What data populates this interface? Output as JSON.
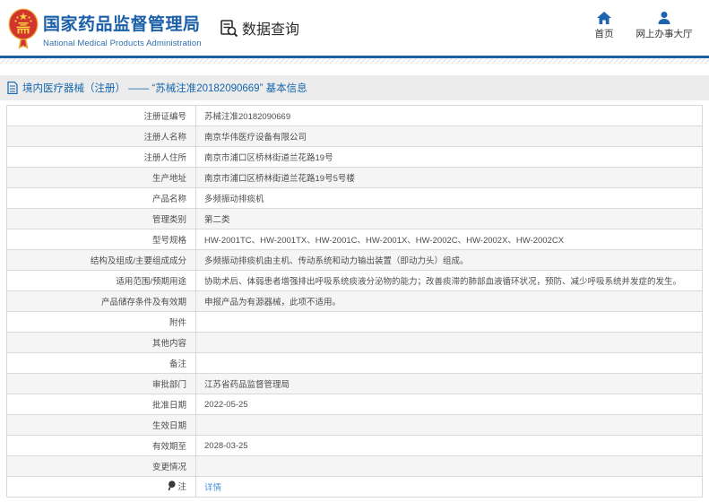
{
  "header": {
    "title": "国家药品监督管理局",
    "subtitle": "National Medical Products Administration",
    "nav": {
      "data_query": "数据查询"
    },
    "quick_links": {
      "home": "首页",
      "service_hall": "网上办事大厅"
    }
  },
  "icons": {
    "emblem": "china-national-emblem",
    "data_query": "document-magnifier",
    "home": "home",
    "service_hall": "person",
    "breadcrumb": "document",
    "note": "pin"
  },
  "colors": {
    "brand_blue": "#1b5fa8",
    "line_blue": "#1c5fa5",
    "link_blue": "#4a90d9",
    "breadcrumb_bg": "#ececec",
    "stripe": "#f5f5f5"
  },
  "breadcrumb": {
    "text": "境内医疗器械（注册） —— “苏械注准20182090669” 基本信息"
  },
  "table": {
    "rows": [
      {
        "label": "注册证编号",
        "value": "苏械注准20182090669"
      },
      {
        "label": "注册人名称",
        "value": "南京华伟医疗设备有限公司"
      },
      {
        "label": "注册人住所",
        "value": "南京市浦口区桥林街道兰花路19号"
      },
      {
        "label": "生产地址",
        "value": "南京市浦口区桥林街道兰花路19号5号楼"
      },
      {
        "label": "产品名称",
        "value": "多频振动排痰机"
      },
      {
        "label": "管理类别",
        "value": "第二类"
      },
      {
        "label": "型号规格",
        "value": "HW-2001TC、HW-2001TX、HW-2001C、HW-2001X、HW-2002C、HW-2002X、HW-2002CX"
      },
      {
        "label": "结构及组成/主要组成成分",
        "value": "多频振动排痰机由主机、传动系统和动力输出装置（即动力头）组成。"
      },
      {
        "label": "适用范围/预期用途",
        "value": "协助术后、体弱患者增强排出呼吸系统痰液分泌物的能力；改善痰滞的肺部血液循环状况，预防、减少呼吸系统并发症的发生。"
      },
      {
        "label": "产品储存条件及有效期",
        "value": "申报产品为有源器械，此项不适用。"
      },
      {
        "label": "附件",
        "value": ""
      },
      {
        "label": "其他内容",
        "value": ""
      },
      {
        "label": "备注",
        "value": ""
      },
      {
        "label": "审批部门",
        "value": "江苏省药品监督管理局"
      },
      {
        "label": "批准日期",
        "value": "2022-05-25"
      },
      {
        "label": "生效日期",
        "value": ""
      },
      {
        "label": "有效期至",
        "value": "2028-03-25"
      },
      {
        "label": "变更情况",
        "value": ""
      },
      {
        "label": "注",
        "value": "详情"
      }
    ]
  }
}
